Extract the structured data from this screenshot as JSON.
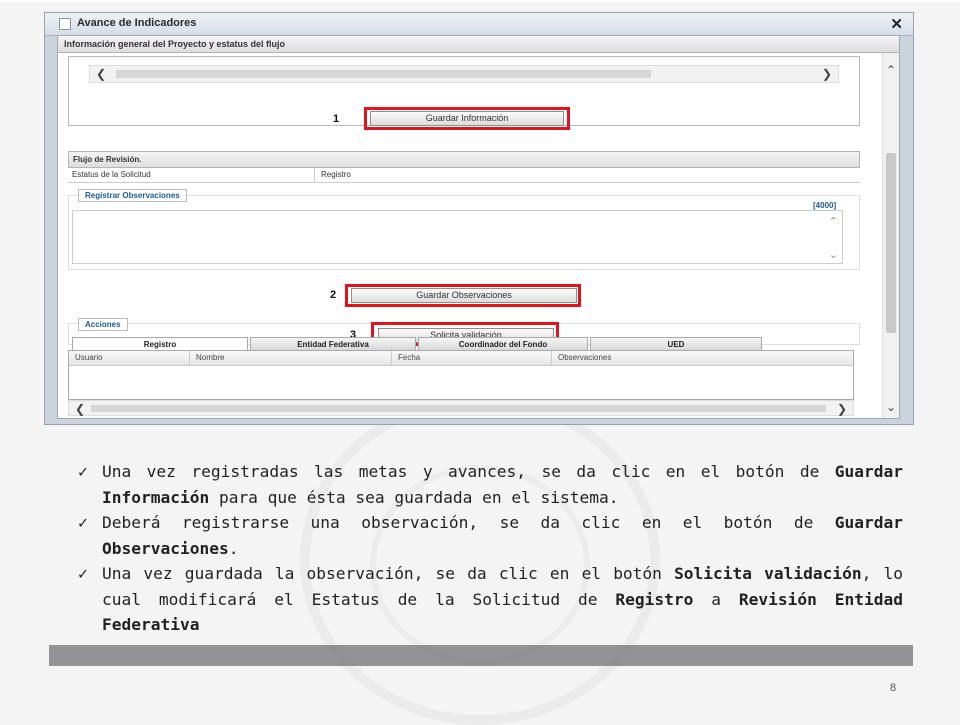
{
  "window": {
    "title": "Avance de Indicadores",
    "close": "✕",
    "section_header": "Información general del Proyecto y estatus del flujo"
  },
  "step1": {
    "number": "1",
    "button": "Guardar Información"
  },
  "flujo": {
    "header": "Flujo de Revisión.",
    "estatus_label": "Estatus de la Solicitud",
    "estatus_value": "Registro"
  },
  "observaciones": {
    "legend": "Registrar Observaciones",
    "counter": "[4000]",
    "textarea_value": ""
  },
  "step2": {
    "number": "2",
    "button": "Guardar Observaciones"
  },
  "acciones": {
    "legend": "Acciones"
  },
  "step3": {
    "number": "3",
    "button": "Solicita validación"
  },
  "tabs": [
    "Registro",
    "Entidad Federativa",
    "Coordinador del Fondo",
    "UED"
  ],
  "grid_columns": [
    "Usuario",
    "Nombre",
    "Fecha",
    "Observaciones"
  ],
  "bullets": [
    {
      "pre": "Una vez registradas las metas y avances, se da clic en el botón de ",
      "bold1": "Guardar Información",
      "post": " para que ésta sea guardada en el sistema."
    },
    {
      "pre": "Deberá registrarse una observación, se da clic en el botón de ",
      "bold1": "Guardar Observaciones",
      "post": "."
    },
    {
      "pre": "Una vez guardada la observación, se da clic en el botón ",
      "bold1": "Solicita validación",
      "mid": ", lo cual modificará el Estatus de la Solicitud de ",
      "bold2": "Registro",
      "mid2": " a ",
      "bold3": "Revisión Entidad Federativa"
    }
  ],
  "check_symbol": "✓",
  "page_number": "8",
  "colors": {
    "highlight_red": "#e0141e",
    "legend_blue": "#1a5a9a"
  }
}
